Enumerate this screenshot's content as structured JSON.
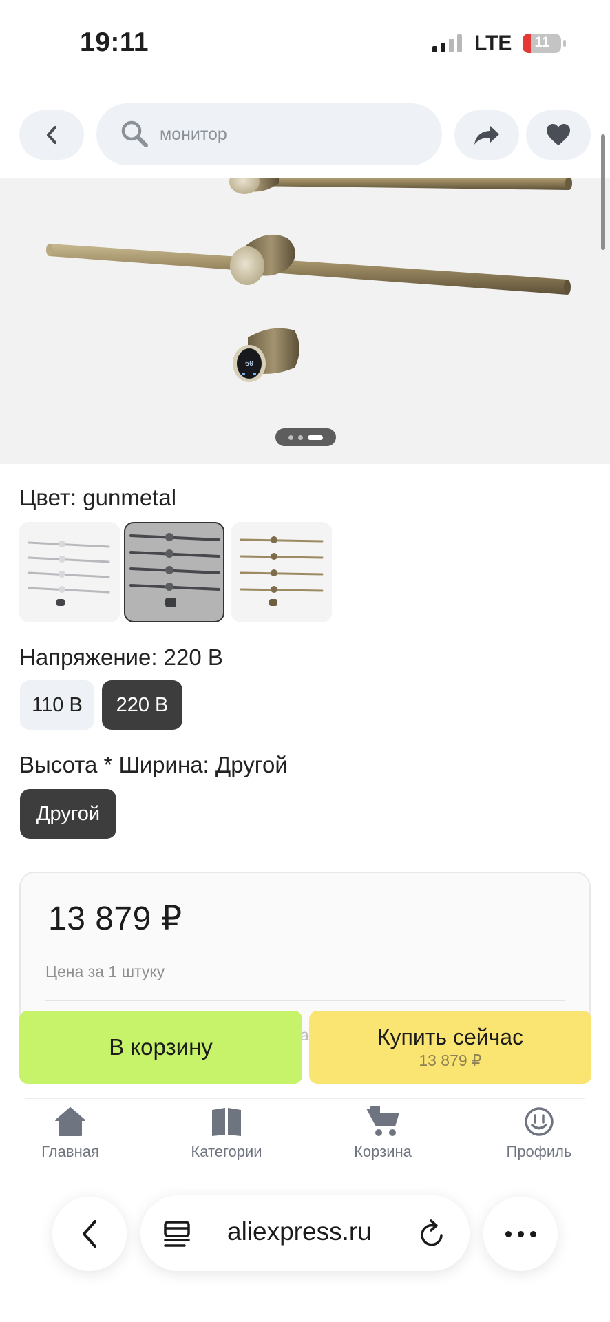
{
  "status_bar": {
    "time": "19:11",
    "network": "LTE",
    "battery": "11"
  },
  "header": {
    "search_placeholder": "монитор",
    "icons": {
      "back": "chevron-left-icon",
      "search": "search-icon",
      "share": "share-icon",
      "favorite": "heart-icon"
    }
  },
  "gallery": {
    "image_count": 3,
    "active_index": 3,
    "display_value": "60"
  },
  "color_option": {
    "label": "Цвет: gunmetal",
    "swatches": [
      {
        "name": "silver",
        "selected": false
      },
      {
        "name": "gunmetal",
        "selected": true
      },
      {
        "name": "gold",
        "selected": false
      }
    ]
  },
  "voltage_option": {
    "label": "Напряжение: 220 В",
    "chips": [
      {
        "label": "110 В",
        "selected": false
      },
      {
        "label": "220 В",
        "selected": true
      }
    ]
  },
  "size_option": {
    "label": "Высота * Ширина: Другой",
    "chips": [
      {
        "label": "Другой",
        "selected": true
      }
    ]
  },
  "price": {
    "value": "13 879 ₽",
    "note": "Цена за 1 штуку",
    "peek": "а"
  },
  "actions": {
    "cart_label": "В корзину",
    "buy_label": "Купить сейчас",
    "buy_price": "13 879 ₽"
  },
  "bottom_nav": [
    {
      "label": "Главная",
      "icon": "home-icon"
    },
    {
      "label": "Категории",
      "icon": "book-icon"
    },
    {
      "label": "Корзина",
      "icon": "cart-icon"
    },
    {
      "label": "Профиль",
      "icon": "smiley-icon"
    }
  ],
  "browser": {
    "url": "aliexpress.ru",
    "icons": [
      "chevron-left-icon",
      "page-menu-icon",
      "reload-icon",
      "more-icon"
    ]
  },
  "colors": {
    "cart_button": "#c6f36a",
    "buy_button": "#fae472",
    "chip_selected": "#3d3d3d",
    "chip_unselected": "#eef1f5",
    "brass": "#9b8a62"
  }
}
